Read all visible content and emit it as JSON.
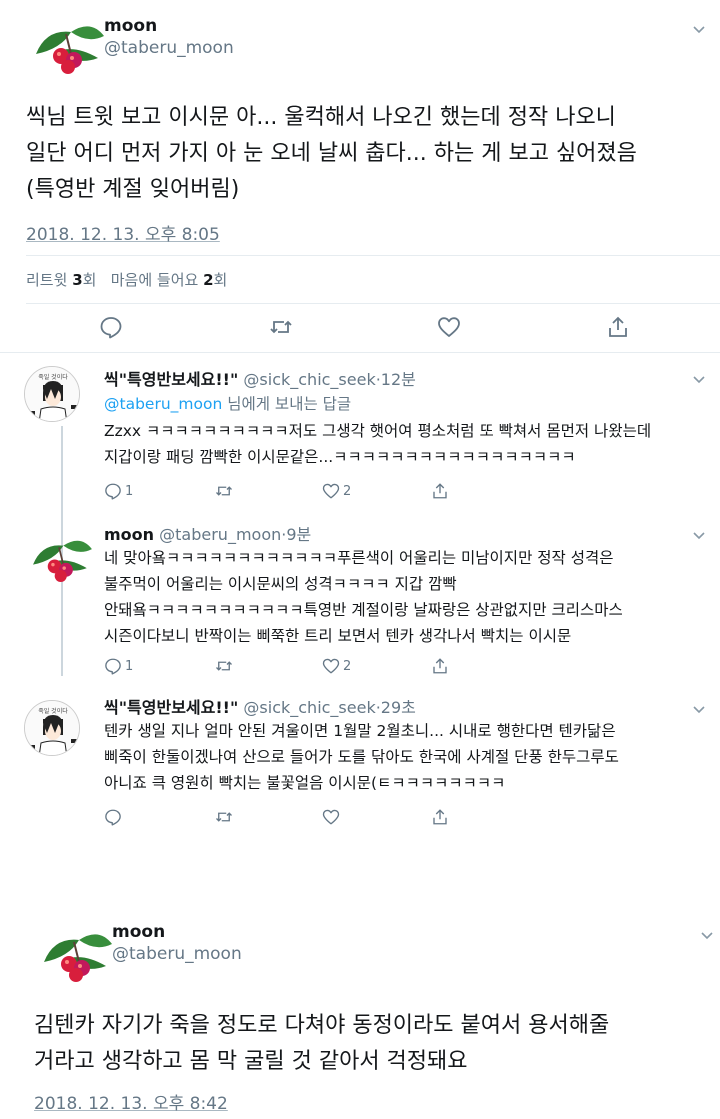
{
  "tweet1": {
    "name": "moon",
    "handle": "@taberu_moon",
    "text_lines": [
      "씩님 트윗 보고 이시문 아... 울컥해서 나오긴 했는데 정작 나오니",
      "일단 어디  먼저 가지 아 눈 오네 날씨 춥다... 하는 게 보고 싶어졌음",
      "(특영반 계절 잊어버림)"
    ],
    "date": "2018. 12. 13. 오후 8:05",
    "stats": {
      "retweet_label": "리트윗",
      "retweet_count": "3",
      "retweet_unit": "회",
      "like_label": "마음에 들어요",
      "like_count": "2",
      "like_unit": "회"
    }
  },
  "replies": [
    {
      "name": "씩\"특영반보세요!!\"",
      "handle": "@sick_chic_seek",
      "time": "·12분",
      "reply_to_handle": "@taberu_moon",
      "reply_to_suffix": " 님에게 보내는 답글",
      "text_lines": [
        "Zzxx ㅋㅋㅋㅋㅋㅋㅋㅋㅋㅋ저도 그생각 햇어여 평소처럼 또 빡쳐서 몸먼저 나왔는데",
        "지갑이랑 패딩 깜빡한 이시문같은...ㅋㅋㅋㅋㅋㅋㅋㅋㅋㅋㅋㅋㅋㅋㅋㅋㅋ"
      ],
      "reply_count": "1",
      "like_count": "2",
      "avatar_text": "죽일 것이다"
    },
    {
      "name": "moon",
      "handle": "@taberu_moon",
      "time": "·9분",
      "text_lines": [
        "네 맞아욬ㅋㅋㅋㅋㅋㅋㅋㅋㅋㅋㅋㅋ푸른색이 어울리는 미남이지만 정작 성격은",
        "불주먹이 어울리는 이시문씨의 성격ㅋㅋㅋㅋ 지갑 깜빡",
        "안돼욬ㅋㅋㅋㅋㅋㅋㅋㅋㅋㅋㅋ특영반 계절이랑 날짜랑은 상관없지만 크리스마스",
        "시즌이다보니 반짝이는 삐쭉한 트리 보면서 텐카 생각나서 빡치는 이시문"
      ],
      "reply_count": "1",
      "like_count": "2"
    },
    {
      "name": "씩\"특영반보세요!!\"",
      "handle": "@sick_chic_seek",
      "time": "·29초",
      "text_lines": [
        "텐카 생일 지나 얼마 안된 겨울이면 1월말 2월초니... 시내로 행한다면 텐카닮은",
        "삐죽이 한둘이겠나여 산으로 들어가 도를 닦아도 한국에 사계절 단풍 한두그루도",
        "아니죠 큭 영원히 빡치는 불꽃얼음 이시문(ㅌㅋㅋㅋㅋㅋㅋㅋㅋ"
      ],
      "avatar_text": "죽일 것이다"
    }
  ],
  "tweet2": {
    "name": "moon",
    "handle": "@taberu_moon",
    "text_lines": [
      "김텐카 자기가 죽을 정도로 다쳐야 동정이라도 붙여서 용서해줄",
      "거라고 생각하고 몸 막 굴릴 것 같아서 걱정돼요"
    ],
    "date": "2018. 12. 13. 오후 8:42"
  },
  "colors": {
    "accent": "#1da1f2",
    "secondary_text": "#657786",
    "berry_red": "#d81e3c",
    "leaf_green": "#2e7d32"
  }
}
